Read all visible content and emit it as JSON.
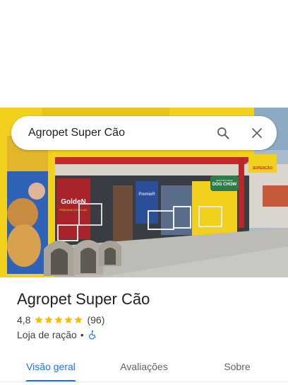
{
  "search": {
    "query": "Agropet Super Cão"
  },
  "icons": {
    "search": "search-icon",
    "close": "close-icon",
    "star": "star-icon",
    "accessibility": "wheelchair-icon"
  },
  "place": {
    "name": "Agropet Super Cão",
    "rating": "4,8",
    "stars": 5,
    "reviews_count": "(96)",
    "category": "Loja de ração",
    "separator": "•"
  },
  "tabs": [
    {
      "label": "Visão geral",
      "active": true
    },
    {
      "label": "Avaliações",
      "active": false
    },
    {
      "label": "Sobre",
      "active": false
    }
  ],
  "photo_signage": {
    "brand_left": "GoldeN",
    "brand_left_sub": "PREMIUM ESPECIAL",
    "brand_center": "PremieR",
    "brand_right": "DOG CHOW",
    "brand_right_sub": "NESTLÉ PURINA",
    "store_banner": "SUPERCÃO"
  },
  "colors": {
    "accent": "#1a73e8",
    "star": "#fbbc04",
    "text_primary": "#202124",
    "text_secondary": "#3c4043"
  }
}
